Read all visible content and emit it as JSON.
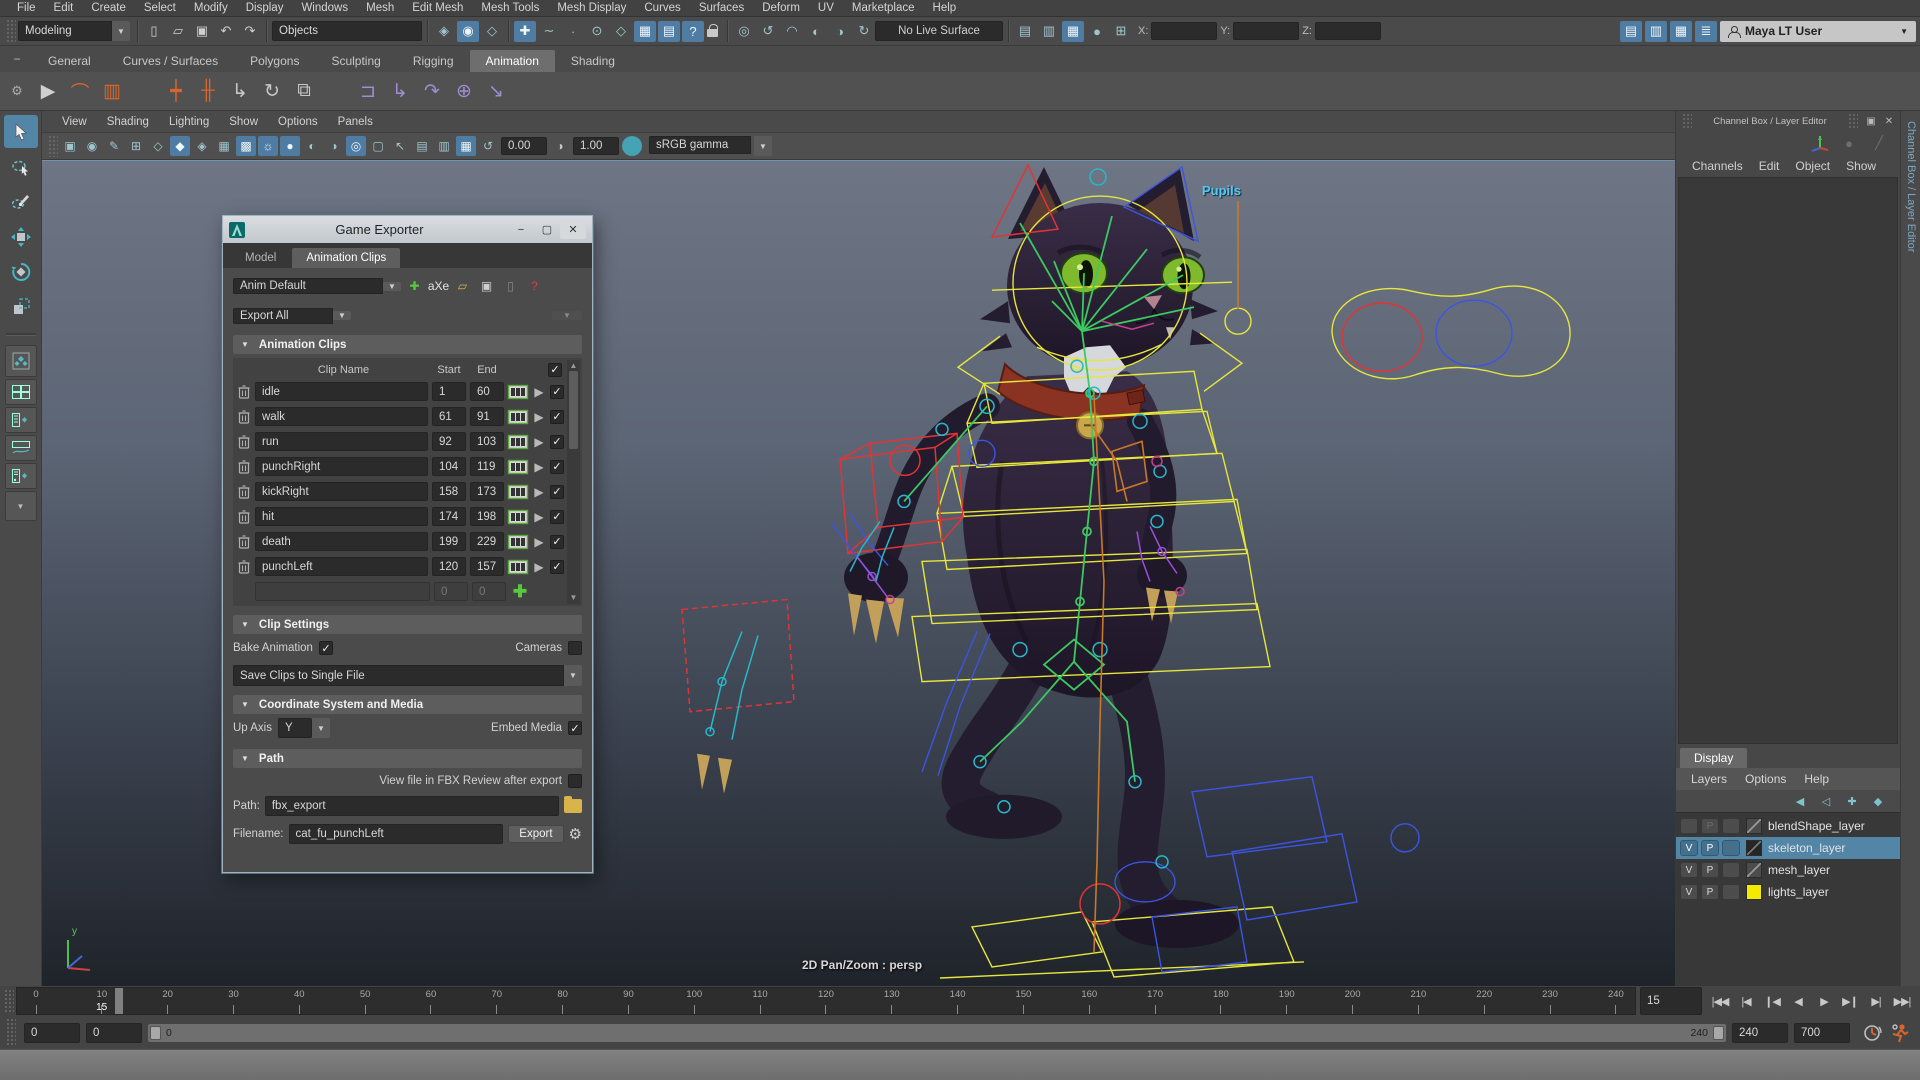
{
  "glyphs": {
    "check": "✓",
    "dropdown": "▼",
    "collapse": "▼",
    "play": "▶",
    "plus": "+",
    "minimize": "−",
    "maximize": "▢",
    "close": "✕",
    "popout": "▣",
    "menu": "≡",
    "gear": "⚙",
    "add": "✚"
  },
  "menubar": {
    "items": [
      "File",
      "Edit",
      "Create",
      "Select",
      "Modify",
      "Display",
      "Windows",
      "Mesh",
      "Edit Mesh",
      "Mesh Tools",
      "Mesh Display",
      "Curves",
      "Surfaces",
      "Deform",
      "UV",
      "Marketplace",
      "Help"
    ]
  },
  "statusline": {
    "menuset": "Modeling",
    "selection_mask": "Objects",
    "live_surface": "No Live Surface",
    "coord_labels": {
      "x": "X:",
      "y": "Y:",
      "z": "Z:"
    },
    "coord_values": {
      "x": "",
      "y": "",
      "z": ""
    },
    "user": "Maya LT User",
    "file_icons": [
      {
        "name": "new-scene-icon",
        "glyph": "▯",
        "color": "#cfcfcf"
      },
      {
        "name": "open-scene-icon",
        "glyph": "▱",
        "color": "#cfcfcf"
      },
      {
        "name": "save-scene-icon",
        "glyph": "▣",
        "color": "#cfcfcf"
      },
      {
        "name": "undo-icon",
        "glyph": "↶",
        "color": "#cfcfcf"
      },
      {
        "name": "redo-icon",
        "glyph": "↷",
        "color": "#cfcfcf"
      }
    ],
    "select_icons": [
      {
        "name": "select-by-hierarchy-icon",
        "glyph": "◈"
      },
      {
        "name": "select-by-object-icon",
        "glyph": "◉",
        "active": true
      },
      {
        "name": "select-by-component-icon",
        "glyph": "◇"
      }
    ],
    "snap_icons": [
      {
        "name": "snap-to-grid-icon",
        "glyph": "✚",
        "active": true
      },
      {
        "name": "snap-to-curve-icon",
        "glyph": "∼"
      },
      {
        "name": "snap-to-point-icon",
        "glyph": "∙"
      },
      {
        "name": "snap-to-projected-center-icon",
        "glyph": "⊙"
      },
      {
        "name": "snap-to-view-plane-icon",
        "glyph": "◇"
      },
      {
        "name": "make-live-icon",
        "glyph": "▦",
        "active": true
      },
      {
        "name": "snap-together-icon",
        "glyph": "▤",
        "active": true
      },
      {
        "name": "snap-help-icon",
        "glyph": "?",
        "active": true
      }
    ],
    "history_icons": [
      {
        "name": "construction-history-icon",
        "glyph": "◎"
      },
      {
        "name": "rebuild-icon",
        "glyph": "↺"
      },
      {
        "name": "curve-precision-icon",
        "glyph": "◠"
      },
      {
        "name": "soft-select-icon",
        "glyph": "◐"
      },
      {
        "name": "symmetry-icon",
        "glyph": "◑"
      },
      {
        "name": "reflection-icon",
        "glyph": "↻"
      }
    ],
    "panel_icons": [
      {
        "name": "open-editor-left-icon",
        "glyph": "▤"
      },
      {
        "name": "open-editor-right-icon",
        "glyph": "▥"
      },
      {
        "name": "recent-commands-icon",
        "glyph": "▦",
        "active": true
      },
      {
        "name": "render-sphere-icon",
        "glyph": "●"
      },
      {
        "name": "grid-coords-icon",
        "glyph": "⊞"
      }
    ],
    "workspace_icons": [
      {
        "name": "workspace-modeling-icon",
        "glyph": "▤",
        "active": true
      },
      {
        "name": "workspace-anim-icon",
        "glyph": "▥",
        "active": true
      },
      {
        "name": "workspace-render-icon",
        "glyph": "▦",
        "active": true
      },
      {
        "name": "workspace-layers-icon",
        "glyph": "≣",
        "active": true
      }
    ]
  },
  "shelf": {
    "tabs": [
      "General",
      "Curves / Surfaces",
      "Polygons",
      "Sculpting",
      "Rigging",
      "Animation",
      "Shading"
    ],
    "active_tab": "Animation",
    "icons": [
      {
        "name": "playblast-icon",
        "glyph": "▶",
        "color": "#d0d0d0"
      },
      {
        "name": "set-driven-key-icon",
        "glyph": "⌒",
        "color": "#d9652c"
      },
      {
        "name": "graph-editor-icon",
        "glyph": "▥",
        "color": "#d9652c"
      },
      {
        "name": "divider",
        "glyph": "",
        "color": "#444"
      },
      {
        "name": "set-key-icon",
        "glyph": "┿",
        "color": "#d9652c"
      },
      {
        "name": "set-key-options-icon",
        "glyph": "╫",
        "color": "#d9652c"
      },
      {
        "name": "set-translate-key-icon",
        "glyph": "↳",
        "color": "#c8c8c8"
      },
      {
        "name": "set-rotate-key-icon",
        "glyph": "↻",
        "color": "#c8c8c8"
      },
      {
        "name": "set-scale-key-icon",
        "glyph": "⧉",
        "color": "#c8c8c8"
      },
      {
        "name": "divider",
        "glyph": "",
        "color": "#444"
      },
      {
        "name": "parent-constraint-icon",
        "glyph": "⊐",
        "color": "#a08cd0"
      },
      {
        "name": "point-constraint-icon",
        "glyph": "↳",
        "color": "#a08cd0"
      },
      {
        "name": "orient-constraint-icon",
        "glyph": "↷",
        "color": "#a08cd0"
      },
      {
        "name": "aim-constraint-icon",
        "glyph": "⊕",
        "color": "#a08cd0"
      },
      {
        "name": "pole-vector-icon",
        "glyph": "↘",
        "color": "#a08cd0"
      }
    ]
  },
  "viewport": {
    "menus": [
      "View",
      "Shading",
      "Lighting",
      "Show",
      "Options",
      "Panels"
    ],
    "toolbar_icons": [
      {
        "name": "select-camera-icon",
        "glyph": "▣"
      },
      {
        "name": "camera-attributes-icon",
        "glyph": "◉"
      },
      {
        "name": "bookmark-icon",
        "glyph": "✎"
      },
      {
        "name": "grid-toggle-icon",
        "glyph": "⊞"
      },
      {
        "name": "wireframe-icon",
        "glyph": "◇"
      },
      {
        "name": "shaded-icon",
        "glyph": "◆",
        "active": true
      },
      {
        "name": "wireframe-on-shaded-icon",
        "glyph": "◈"
      },
      {
        "name": "textured-icon",
        "glyph": "▦"
      },
      {
        "name": "use-default-material-icon",
        "glyph": "▩",
        "active": true
      },
      {
        "name": "lighting-icon",
        "glyph": "☼",
        "active": true
      },
      {
        "name": "shadows-icon",
        "glyph": "●",
        "active": true
      },
      {
        "name": "occlusion-icon",
        "glyph": "◐"
      },
      {
        "name": "motion-blur-icon",
        "glyph": "◑"
      },
      {
        "name": "multisample-icon",
        "glyph": "◎",
        "active": true
      },
      {
        "name": "depth-peel-icon",
        "glyph": "▢"
      },
      {
        "name": "isolate-select-icon",
        "glyph": "↖"
      },
      {
        "name": "pane-single-icon",
        "glyph": "▤"
      },
      {
        "name": "pane-split-icon",
        "glyph": "▥"
      },
      {
        "name": "pane-quad-icon",
        "glyph": "▦",
        "active": true
      },
      {
        "name": "exposure-icon",
        "glyph": "↺"
      }
    ],
    "exposure": "0.00",
    "gamma_icon": "◑",
    "gamma": "1.00",
    "color_transform": "sRGB gamma",
    "overlay_label": "2D Pan/Zoom : persp",
    "pupils_label": "Pupils",
    "axis_label": "y"
  },
  "game_exporter": {
    "title": "Game Exporter",
    "tabs": [
      "Model",
      "Animation Clips"
    ],
    "active_tab": "Animation Clips",
    "preset": "Anim Default",
    "preset_icons": [
      {
        "name": "new-preset-icon",
        "glyph": "✚",
        "color": "#58c83e"
      },
      {
        "name": "rename-preset-icon",
        "glyph": "aXe",
        "color": "#e2e2e2"
      },
      {
        "name": "load-preset-icon",
        "glyph": "▱",
        "color": "#d8b44a"
      },
      {
        "name": "save-preset-icon",
        "glyph": "▣",
        "color": "#cfcfcf"
      },
      {
        "name": "delete-preset-icon",
        "glyph": "▯",
        "color": "#8a8a8a"
      },
      {
        "name": "preset-help-icon",
        "glyph": "?",
        "color": "#d04545"
      }
    ],
    "export_mode": "Export All",
    "sections": {
      "clips": "Animation Clips",
      "clip_settings": "Clip Settings",
      "coord": "Coordinate System and Media",
      "path": "Path"
    },
    "table": {
      "headers": {
        "name": "Clip Name",
        "start": "Start",
        "end": "End"
      },
      "clips": [
        {
          "name": "idle",
          "start": "1",
          "end": "60"
        },
        {
          "name": "walk",
          "start": "61",
          "end": "91"
        },
        {
          "name": "run",
          "start": "92",
          "end": "103"
        },
        {
          "name": "punchRight",
          "start": "104",
          "end": "119"
        },
        {
          "name": "kickRight",
          "start": "158",
          "end": "173"
        },
        {
          "name": "hit",
          "start": "174",
          "end": "198"
        },
        {
          "name": "death",
          "start": "199",
          "end": "229"
        },
        {
          "name": "punchLeft",
          "start": "120",
          "end": "157"
        }
      ],
      "empty_start": "0",
      "empty_end": "0"
    },
    "clip_settings": {
      "bake_label": "Bake Animation",
      "cameras_label": "Cameras",
      "file_mode": "Save Clips to Single File"
    },
    "coord": {
      "up_axis_label": "Up Axis",
      "up_axis": "Y",
      "embed_label": "Embed Media"
    },
    "path": {
      "fbx_review_label": "View file in FBX Review after export",
      "path_label": "Path:",
      "path_value": "fbx_export",
      "filename_label": "Filename:",
      "filename_value": "cat_fu_punchLeft",
      "export_button": "Export"
    }
  },
  "channel_box": {
    "title": "Channel Box / Layer Editor",
    "menus": [
      "Channels",
      "Edit",
      "Object",
      "Show"
    ],
    "vertical_tab": "Channel Box / Layer Editor"
  },
  "layer_editor": {
    "tab": "Display",
    "menus": [
      "Layers",
      "Options",
      "Help"
    ],
    "icons": [
      {
        "name": "move-layer-up-icon",
        "glyph": "◀"
      },
      {
        "name": "move-layer-down-icon",
        "glyph": "◁"
      },
      {
        "name": "new-layer-icon",
        "glyph": "✚"
      },
      {
        "name": "new-layer-selected-icon",
        "glyph": "◆"
      }
    ],
    "layers": [
      {
        "v": "",
        "p": "P",
        "name": "blendShape_layer"
      },
      {
        "v": "V",
        "p": "P",
        "name": "skeleton_layer"
      },
      {
        "v": "V",
        "p": "P",
        "name": "mesh_layer"
      },
      {
        "v": "V",
        "p": "P",
        "name": "lights_layer"
      }
    ]
  },
  "timeline": {
    "ticks": [
      "0",
      "10",
      "20",
      "30",
      "40",
      "50",
      "60",
      "70",
      "80",
      "90",
      "100",
      "110",
      "120",
      "130",
      "140",
      "150",
      "160",
      "170",
      "180",
      "190",
      "200",
      "210",
      "220",
      "230",
      "240"
    ],
    "current_frame": "15",
    "current_frame_field": "15",
    "groove_start": "0",
    "groove_end": "240",
    "anim_start": "0",
    "playback_start": "0",
    "playback_end": "240",
    "anim_end": "700",
    "playback_buttons": [
      {
        "name": "go-to-start-button",
        "glyph": "|◀◀"
      },
      {
        "name": "step-back-frame-button",
        "glyph": "|◀"
      },
      {
        "name": "step-back-key-button",
        "glyph": "❙◀",
        "key": true
      },
      {
        "name": "play-backwards-button",
        "glyph": "◀"
      },
      {
        "name": "play-forwards-button",
        "glyph": "▶"
      },
      {
        "name": "step-forward-key-button",
        "glyph": "▶❙",
        "key": true
      },
      {
        "name": "step-forward-frame-button",
        "glyph": "▶|"
      },
      {
        "name": "go-to-end-button",
        "glyph": "▶▶|"
      }
    ]
  }
}
